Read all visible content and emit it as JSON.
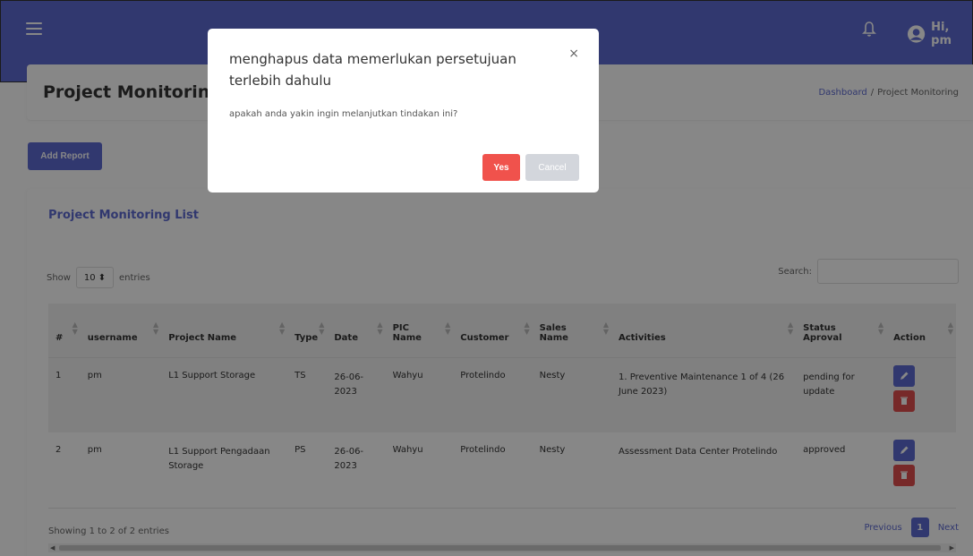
{
  "navbar": {
    "menu_icon": "hamburger-icon",
    "bell_icon": "bell-icon",
    "avatar_icon": "user-avatar-icon",
    "greeting": "Hi, pm"
  },
  "header": {
    "title": "Project Monitoring",
    "breadcrumb": {
      "home": "Dashboard",
      "separator": "/",
      "current": "Project Monitoring"
    }
  },
  "add_report_label": "Add Report",
  "list": {
    "title": "Project Monitoring List",
    "show_label": "Show",
    "entries_value": "10",
    "entries_label": "entries",
    "search_label": "Search:",
    "columns": [
      "#",
      "username",
      "Project Name",
      "Type",
      "Date",
      "PIC Name",
      "Customer",
      "Sales Name",
      "Activities",
      "Status Aproval",
      "Action"
    ],
    "rows": [
      {
        "no": "1",
        "username": "pm",
        "project": "L1 Support Storage",
        "type": "TS",
        "date": "26-06-2023",
        "pic": "Wahyu",
        "customer": "Protelindo",
        "sales": "Nesty",
        "activities": "1. Preventive Maintenance 1 of 4 (26 June 2023)",
        "status": "pending for update"
      },
      {
        "no": "2",
        "username": "pm",
        "project": "L1 Support Pengadaan Storage",
        "type": "PS",
        "date": "26-06-2023",
        "pic": "Wahyu",
        "customer": "Protelindo",
        "sales": "Nesty",
        "activities": "Assessment Data Center Protelindo",
        "status": "approved"
      }
    ],
    "info": "Showing 1 to 2 of 2 entries",
    "pagination": {
      "previous": "Previous",
      "page": "1",
      "next": "Next"
    }
  },
  "modal": {
    "title": "menghapus data memerlukan persetujuan terlebih dahulu",
    "body": "apakah anda yakin ingin melanjutkan tindakan ini?",
    "yes_label": "Yes",
    "cancel_label": "Cancel",
    "close_glyph": "×"
  },
  "colors": {
    "primary": "#5e6ad2",
    "danger": "#e14e4e",
    "yes": "#f0524c",
    "cancel": "#d3d6dc"
  }
}
